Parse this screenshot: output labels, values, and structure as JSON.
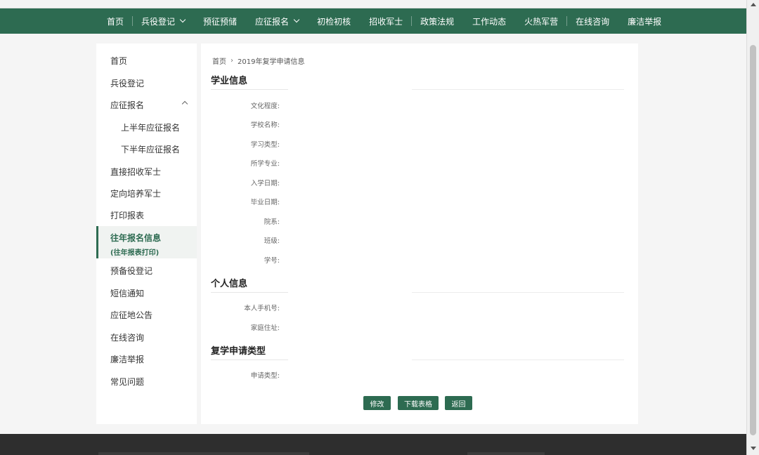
{
  "nav": {
    "items": [
      {
        "label": "首页"
      },
      {
        "label": "兵役登记"
      },
      {
        "label": "预征预储"
      },
      {
        "label": "应征报名"
      },
      {
        "label": "初检初核"
      },
      {
        "label": "招收军士"
      },
      {
        "label": "政策法规"
      },
      {
        "label": "工作动态"
      },
      {
        "label": "火热军营"
      },
      {
        "label": "在线咨询"
      },
      {
        "label": "廉洁举报"
      }
    ]
  },
  "sidebar": {
    "items": [
      {
        "label": "首页"
      },
      {
        "label": "兵役登记"
      },
      {
        "label": "应征报名"
      },
      {
        "label": "上半年应征报名"
      },
      {
        "label": "下半年应征报名"
      },
      {
        "label": "直接招收军士"
      },
      {
        "label": "定向培养军士"
      },
      {
        "label": "打印报表"
      },
      {
        "label": "往年报名信息",
        "label2": "(往年报表打印)"
      },
      {
        "label": "预备役登记"
      },
      {
        "label": "短信通知"
      },
      {
        "label": "应征地公告"
      },
      {
        "label": "在线咨询"
      },
      {
        "label": "廉洁举报"
      },
      {
        "label": "常见问题"
      }
    ]
  },
  "breadcrumb": {
    "home": "首页",
    "separator": "›",
    "current": "2019年复学申请信息"
  },
  "sections": {
    "academic": {
      "title": "学业信息",
      "fields": [
        "文化程度:",
        "学校名称:",
        "学习类型:",
        "所学专业:",
        "入学日期:",
        "毕业日期:",
        "院系:",
        "班级:",
        "学号:"
      ]
    },
    "personal": {
      "title": "个人信息",
      "fields": [
        "本人手机号:",
        "家庭住址:"
      ]
    },
    "type": {
      "title": "复学申请类型",
      "fields": [
        "申请类型:"
      ]
    }
  },
  "buttons": {
    "edit": "修改",
    "download": "下载表格",
    "back": "返回"
  },
  "colors": {
    "primary": "#2d6b51",
    "footer": "#2e2e2e"
  }
}
